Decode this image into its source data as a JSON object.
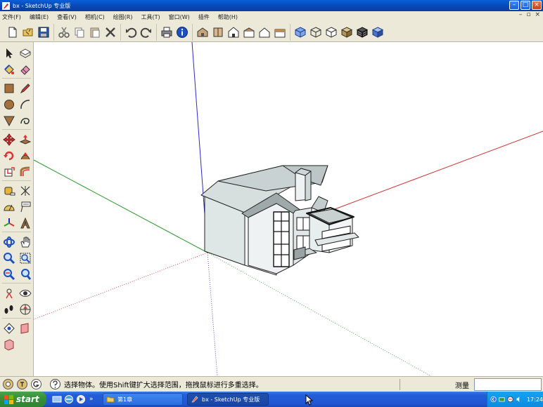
{
  "window": {
    "title": "bx - SketchUp 专业版"
  },
  "menu": {
    "items": [
      "文件(F)",
      "编辑(E)",
      "查看(V)",
      "相机(C)",
      "绘图(R)",
      "工具(T)",
      "窗口(W)",
      "插件",
      "帮助(H)"
    ]
  },
  "toolbar": {
    "icons": [
      "new-icon",
      "open-icon",
      "save-icon",
      "cut-icon",
      "copy-icon",
      "paste-icon",
      "erase-icon",
      "undo-icon",
      "redo-icon",
      "print-icon",
      "model-info-icon",
      "iso-view-icon",
      "top-view-icon",
      "front-view-icon",
      "right-view-icon",
      "back-view-icon",
      "left-view-icon",
      "xray-icon",
      "wireframe-icon",
      "hidden-line-icon",
      "shaded-icon",
      "shaded-textures-icon",
      "monochrome-icon"
    ]
  },
  "status": {
    "hint": "选择物体。使用Shift键扩大选择范围，拖拽鼠标进行多重选择。",
    "measure_label": "测量",
    "measure_value": ""
  },
  "taskbar": {
    "start_label": "start",
    "more": "»",
    "tasks": [
      {
        "label": "第1章"
      },
      {
        "label": "bx - SketchUp 专业版"
      }
    ],
    "clock": "17:24"
  },
  "colors": {
    "axis_red": "#cc2b2b",
    "axis_green": "#2f9a2f",
    "axis_blue": "#2b2bcc",
    "titlebar": "#0845b3",
    "taskbar": "#245ed8"
  }
}
